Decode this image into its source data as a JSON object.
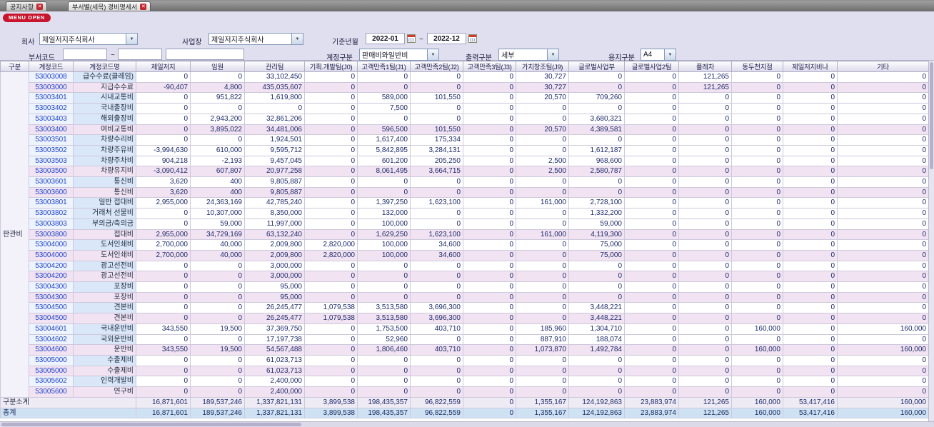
{
  "tabs": [
    {
      "label": "공지사항"
    },
    {
      "label": "부서별(세목) 경비명세서"
    }
  ],
  "menu_button": "MENU OPEN",
  "filters": {
    "company": {
      "label": "회사",
      "value": "제일저지주식회사"
    },
    "workplace": {
      "label": "사업장",
      "value": "제일저지주식회사"
    },
    "period": {
      "label": "기준년월",
      "from": "2022-01",
      "to": "2022-12",
      "separator": "~"
    },
    "dept_code": {
      "label": "부서코드",
      "from": "",
      "to": "",
      "separator": "~"
    },
    "account_group": {
      "label": "계정구분",
      "value": "판매비와일반비"
    },
    "output_type": {
      "label": "출력구분",
      "value": "세부"
    },
    "paper_type": {
      "label": "용지구분",
      "value": "A4"
    }
  },
  "table": {
    "group_label": "판관비",
    "columns": [
      "구분",
      "계정코드",
      "계정코드명",
      "제일저지",
      "임원",
      "관리팀",
      "기획.개발팀(J0)",
      "고객만족1팀(J1)",
      "고객만족2팀(J2)",
      "고객만족3팀(J3)",
      "가치창조팀(J9)",
      "글로벌사업부",
      "글로벌사업2팀",
      "플레차",
      "동두천지점",
      "제일저지비나",
      "기타"
    ],
    "rows": [
      {
        "code": "53003008",
        "name": "급수수료(클레임)",
        "subtotal": false,
        "values": [
          "0",
          "0",
          "33,102,450",
          "0",
          "0",
          "0",
          "0",
          "30,727",
          "0",
          "0",
          "121,265",
          "0",
          "0",
          "0"
        ]
      },
      {
        "code": "53003000",
        "name": "지급수수료",
        "subtotal": true,
        "values": [
          "-90,407",
          "4,800",
          "435,035,607",
          "0",
          "0",
          "0",
          "0",
          "30,727",
          "0",
          "0",
          "121,265",
          "0",
          "0",
          "0"
        ]
      },
      {
        "code": "53003401",
        "name": "시내교통비",
        "subtotal": false,
        "values": [
          "0",
          "951,822",
          "1,619,800",
          "0",
          "589,000",
          "101,550",
          "0",
          "20,570",
          "709,260",
          "0",
          "0",
          "0",
          "0",
          "0"
        ]
      },
      {
        "code": "53003402",
        "name": "국내출장비",
        "subtotal": false,
        "values": [
          "0",
          "0",
          "0",
          "0",
          "7,500",
          "0",
          "0",
          "0",
          "0",
          "0",
          "0",
          "0",
          "0",
          "0"
        ]
      },
      {
        "code": "53003403",
        "name": "해외출장비",
        "subtotal": false,
        "values": [
          "0",
          "2,943,200",
          "32,861,206",
          "0",
          "0",
          "0",
          "0",
          "0",
          "3,680,321",
          "0",
          "0",
          "0",
          "0",
          "0"
        ]
      },
      {
        "code": "53003400",
        "name": "여비교통비",
        "subtotal": true,
        "values": [
          "0",
          "3,895,022",
          "34,481,006",
          "0",
          "596,500",
          "101,550",
          "0",
          "20,570",
          "4,389,581",
          "0",
          "0",
          "0",
          "0",
          "0"
        ]
      },
      {
        "code": "53003501",
        "name": "차량수리비",
        "subtotal": false,
        "values": [
          "0",
          "0",
          "1,924,501",
          "0",
          "1,617,400",
          "175,334",
          "0",
          "0",
          "0",
          "0",
          "0",
          "0",
          "0",
          "0"
        ]
      },
      {
        "code": "53003502",
        "name": "차량주유비",
        "subtotal": false,
        "values": [
          "-3,994,630",
          "610,000",
          "9,595,712",
          "0",
          "5,842,895",
          "3,284,131",
          "0",
          "0",
          "1,612,187",
          "0",
          "0",
          "0",
          "0",
          "0"
        ]
      },
      {
        "code": "53003503",
        "name": "차량주차비",
        "subtotal": false,
        "values": [
          "904,218",
          "-2,193",
          "9,457,045",
          "0",
          "601,200",
          "205,250",
          "0",
          "2,500",
          "968,600",
          "0",
          "0",
          "0",
          "0",
          "0"
        ]
      },
      {
        "code": "53003500",
        "name": "차량유지비",
        "subtotal": true,
        "values": [
          "-3,090,412",
          "607,807",
          "20,977,258",
          "0",
          "8,061,495",
          "3,664,715",
          "0",
          "2,500",
          "2,580,787",
          "0",
          "0",
          "0",
          "0",
          "0"
        ]
      },
      {
        "code": "53003601",
        "name": "통신비",
        "subtotal": false,
        "values": [
          "3,620",
          "400",
          "9,805,887",
          "0",
          "0",
          "0",
          "0",
          "0",
          "0",
          "0",
          "0",
          "0",
          "0",
          "0"
        ]
      },
      {
        "code": "53003600",
        "name": "통신비",
        "subtotal": true,
        "values": [
          "3,620",
          "400",
          "9,805,887",
          "0",
          "0",
          "0",
          "0",
          "0",
          "0",
          "0",
          "0",
          "0",
          "0",
          "0"
        ]
      },
      {
        "code": "53003801",
        "name": "일반 접대비",
        "subtotal": false,
        "values": [
          "2,955,000",
          "24,363,169",
          "42,785,240",
          "0",
          "1,397,250",
          "1,623,100",
          "0",
          "161,000",
          "2,728,100",
          "0",
          "0",
          "0",
          "0",
          "0"
        ]
      },
      {
        "code": "53003802",
        "name": "거래처 선물비",
        "subtotal": false,
        "values": [
          "0",
          "10,307,000",
          "8,350,000",
          "0",
          "132,000",
          "0",
          "0",
          "0",
          "1,332,200",
          "0",
          "0",
          "0",
          "0",
          "0"
        ]
      },
      {
        "code": "53003803",
        "name": "부의금/축의금",
        "subtotal": false,
        "values": [
          "0",
          "59,000",
          "11,997,000",
          "0",
          "100,000",
          "0",
          "0",
          "0",
          "59,000",
          "0",
          "0",
          "0",
          "0",
          "0"
        ]
      },
      {
        "code": "53003800",
        "name": "접대비",
        "subtotal": true,
        "values": [
          "2,955,000",
          "34,729,169",
          "63,132,240",
          "0",
          "1,629,250",
          "1,623,100",
          "0",
          "161,000",
          "4,119,300",
          "0",
          "0",
          "0",
          "0",
          "0"
        ]
      },
      {
        "code": "53004000",
        "name": "도서인쇄비",
        "subtotal": false,
        "values": [
          "2,700,000",
          "40,000",
          "2,009,800",
          "2,820,000",
          "100,000",
          "34,600",
          "0",
          "0",
          "75,000",
          "0",
          "0",
          "0",
          "0",
          "0"
        ]
      },
      {
        "code": "53004000",
        "name": "도서인쇄비",
        "subtotal": true,
        "values": [
          "2,700,000",
          "40,000",
          "2,009,800",
          "2,820,000",
          "100,000",
          "34,600",
          "0",
          "0",
          "75,000",
          "0",
          "0",
          "0",
          "0",
          "0"
        ]
      },
      {
        "code": "53004200",
        "name": "광고선전비",
        "subtotal": false,
        "values": [
          "0",
          "0",
          "3,000,000",
          "0",
          "0",
          "0",
          "0",
          "0",
          "0",
          "0",
          "0",
          "0",
          "0",
          "0"
        ]
      },
      {
        "code": "53004200",
        "name": "광고선전비",
        "subtotal": true,
        "values": [
          "0",
          "0",
          "3,000,000",
          "0",
          "0",
          "0",
          "0",
          "0",
          "0",
          "0",
          "0",
          "0",
          "0",
          "0"
        ]
      },
      {
        "code": "53004300",
        "name": "포장비",
        "subtotal": false,
        "values": [
          "0",
          "0",
          "95,000",
          "0",
          "0",
          "0",
          "0",
          "0",
          "0",
          "0",
          "0",
          "0",
          "0",
          "0"
        ]
      },
      {
        "code": "53004300",
        "name": "포장비",
        "subtotal": true,
        "values": [
          "0",
          "0",
          "95,000",
          "0",
          "0",
          "0",
          "0",
          "0",
          "0",
          "0",
          "0",
          "0",
          "0",
          "0"
        ]
      },
      {
        "code": "53004500",
        "name": "견본비",
        "subtotal": false,
        "values": [
          "0",
          "0",
          "26,245,477",
          "1,079,538",
          "3,513,580",
          "3,696,300",
          "0",
          "0",
          "3,448,221",
          "0",
          "0",
          "0",
          "0",
          "0"
        ]
      },
      {
        "code": "53004500",
        "name": "견본비",
        "subtotal": true,
        "values": [
          "0",
          "0",
          "26,245,477",
          "1,079,538",
          "3,513,580",
          "3,696,300",
          "0",
          "0",
          "3,448,221",
          "0",
          "0",
          "0",
          "0",
          "0"
        ]
      },
      {
        "code": "53004601",
        "name": "국내운반비",
        "subtotal": false,
        "values": [
          "343,550",
          "19,500",
          "37,369,750",
          "0",
          "1,753,500",
          "403,710",
          "0",
          "185,960",
          "1,304,710",
          "0",
          "0",
          "160,000",
          "0",
          "160,000"
        ]
      },
      {
        "code": "53004602",
        "name": "국외운반비",
        "subtotal": false,
        "values": [
          "0",
          "0",
          "17,197,738",
          "0",
          "52,960",
          "0",
          "0",
          "887,910",
          "188,074",
          "0",
          "0",
          "0",
          "0",
          "0"
        ]
      },
      {
        "code": "53004600",
        "name": "운반비",
        "subtotal": true,
        "values": [
          "343,550",
          "19,500",
          "54,567,488",
          "0",
          "1,806,460",
          "403,710",
          "0",
          "1,073,870",
          "1,492,784",
          "0",
          "0",
          "160,000",
          "0",
          "160,000"
        ]
      },
      {
        "code": "53005000",
        "name": "수출제비",
        "subtotal": false,
        "values": [
          "0",
          "0",
          "61,023,713",
          "0",
          "0",
          "0",
          "0",
          "0",
          "0",
          "0",
          "0",
          "0",
          "0",
          "0"
        ]
      },
      {
        "code": "53005000",
        "name": "수출제비",
        "subtotal": true,
        "values": [
          "0",
          "0",
          "61,023,713",
          "0",
          "0",
          "0",
          "0",
          "0",
          "0",
          "0",
          "0",
          "0",
          "0",
          "0"
        ]
      },
      {
        "code": "53005602",
        "name": "인력개발비",
        "subtotal": false,
        "values": [
          "0",
          "0",
          "2,400,000",
          "0",
          "0",
          "0",
          "0",
          "0",
          "0",
          "0",
          "0",
          "0",
          "0",
          "0"
        ]
      },
      {
        "code": "53005600",
        "name": "연구비",
        "subtotal": true,
        "values": [
          "0",
          "0",
          "2,400,000",
          "0",
          "0",
          "0",
          "0",
          "0",
          "0",
          "0",
          "0",
          "0",
          "0",
          "0"
        ]
      }
    ],
    "footers": [
      {
        "label": "구분소계",
        "values": [
          "16,871,601",
          "189,537,246",
          "1,337,821,131",
          "3,899,538",
          "198,435,357",
          "96,822,559",
          "0",
          "1,355,167",
          "124,192,863",
          "23,883,974",
          "121,265",
          "160,000",
          "53,417,416",
          "160,000"
        ]
      },
      {
        "label": "총계",
        "values": [
          "16,871,601",
          "189,537,246",
          "1,337,821,131",
          "3,899,538",
          "198,435,357",
          "96,822,559",
          "0",
          "1,355,167",
          "124,192,863",
          "23,883,974",
          "121,265",
          "160,000",
          "53,417,416",
          "160,000"
        ]
      }
    ]
  }
}
